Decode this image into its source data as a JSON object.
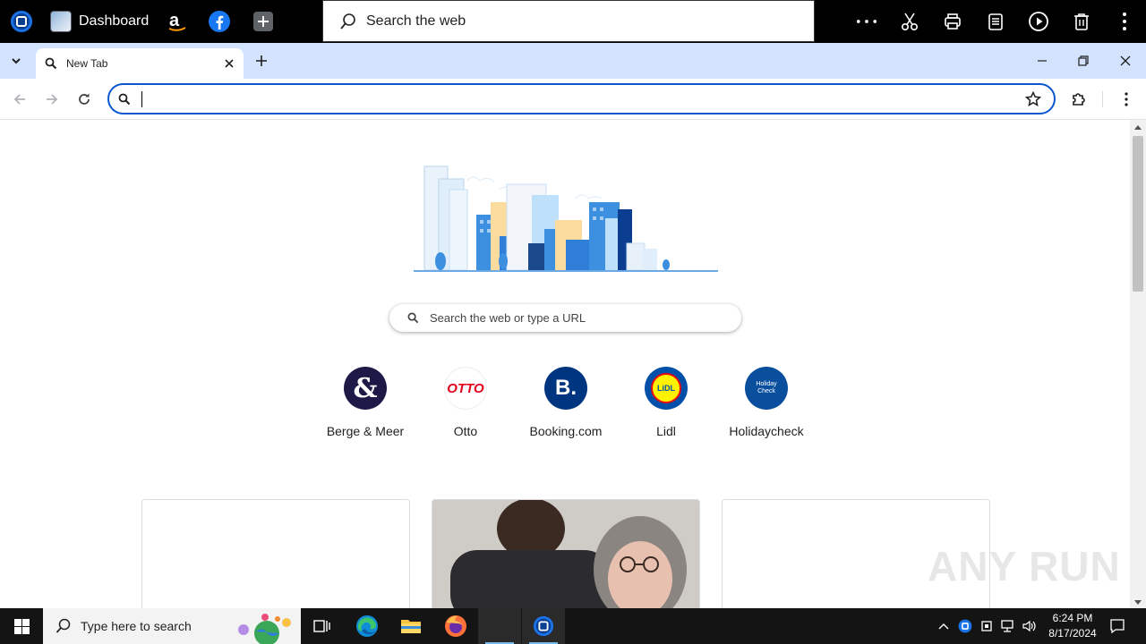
{
  "appbar": {
    "dashboard_label": "Dashboard",
    "websearch_placeholder": "Search the web"
  },
  "tab": {
    "title": "New Tab"
  },
  "ntp": {
    "search_placeholder": "Search the web or type a URL",
    "shortcuts": [
      {
        "label": "Berge & Meer",
        "logo_text": "&",
        "color": "#1d1a47"
      },
      {
        "label": "Otto",
        "logo_text": "OTTO",
        "color": "#e2001a"
      },
      {
        "label": "Booking.com",
        "logo_text": "B.",
        "color": "#003580"
      },
      {
        "label": "Lidl",
        "logo_text": "LiDL",
        "color": "#0050aa"
      },
      {
        "label": "Holidaycheck",
        "logo_text": "Holiday Check",
        "color": "#0a4f9e"
      }
    ]
  },
  "taskbar": {
    "search_placeholder": "Type here to search",
    "time": "6:24 PM",
    "date": "8/17/2024"
  },
  "watermark": "ANY RUN",
  "colors": {
    "accent": "#0b57d0",
    "tabstrip": "#d3e3fd",
    "appbar": "#000000",
    "taskbar": "#141414"
  }
}
